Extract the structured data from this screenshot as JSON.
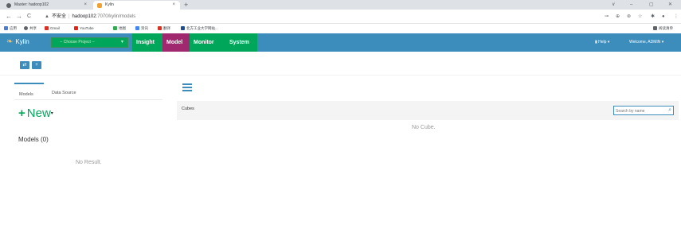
{
  "browser": {
    "tabs": [
      {
        "label": "Master: hadoop102",
        "close": "×"
      },
      {
        "label": "Kylin",
        "close": "×"
      }
    ],
    "new_tab": "+",
    "window_controls": [
      "∨",
      "–",
      "▢",
      "✕"
    ],
    "nav": {
      "back": "←",
      "forward": "→",
      "reload": "C"
    },
    "address": {
      "security_label": "不安全",
      "host": "hadoop102",
      "port": ":7070",
      "path": "/kylin/models"
    },
    "bookmarks": [
      "应用",
      "共享",
      "Gmail",
      "YouTube",
      "地图",
      "资讯",
      "翻译",
      "北方工业大学网站..."
    ],
    "reading_list": "阅读清单"
  },
  "header": {
    "logo_text": "Kylin",
    "project_select": "-- Choose Project --",
    "nav": [
      "Insight",
      "Model",
      "Monitor",
      "System"
    ],
    "active_nav": "Model",
    "help": "Help ▾",
    "user": "Welcome, ADMIN ▾"
  },
  "left": {
    "tabs": [
      "Models",
      "Data Source"
    ],
    "new_label": "New",
    "models_count": "Models (0)",
    "empty": "No Result."
  },
  "right": {
    "panel_title": "Cubes",
    "search_placeholder": "Search by name",
    "empty": "No Cube."
  },
  "colors": {
    "primary": "#3c8dbc",
    "green": "#00a65a",
    "active_nav": "#a0286e"
  }
}
